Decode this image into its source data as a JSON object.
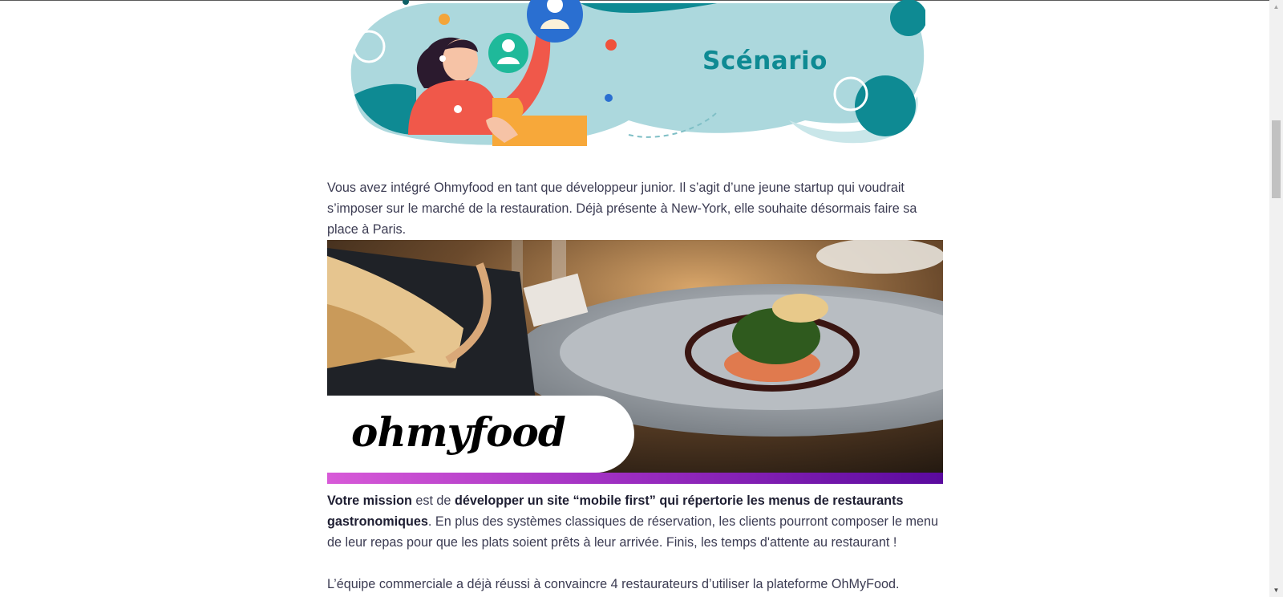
{
  "banner": {
    "title": "Scénario",
    "illustration": "woman-holding-user-profile-icons"
  },
  "intro": {
    "text": "Vous avez intégré Ohmyfood en tant que développeur junior. Il s’agit d’une jeune startup qui voudrait s’imposer sur le marché de la restauration. Déjà présente à New-York, elle souhaite désormais faire sa place à Paris."
  },
  "hero": {
    "logo": "ohmyfood",
    "photo": "gourmet-plate-with-bread-basket"
  },
  "mission": {
    "bold1": "Votre mission",
    "mid": " est de ",
    "bold2": "développer un site “mobile first” qui répertorie les menus de restaurants gastronomiques",
    "rest": ". En plus des systèmes classiques de réservation, les clients pourront composer le menu de leur repas pour que les plats soient prêts à leur arrivée. Finis, les temps d'attente au restaurant !"
  },
  "team": {
    "text": "L’équipe commerciale a déjà réussi à convaincre 4 restaurateurs d’utiliser la plateforme OhMyFood."
  },
  "colors": {
    "accent": "#0e8a93",
    "banner_bg": "#acd8dd",
    "gradient_start": "#d85ad8",
    "gradient_end": "#5a0a9e"
  }
}
